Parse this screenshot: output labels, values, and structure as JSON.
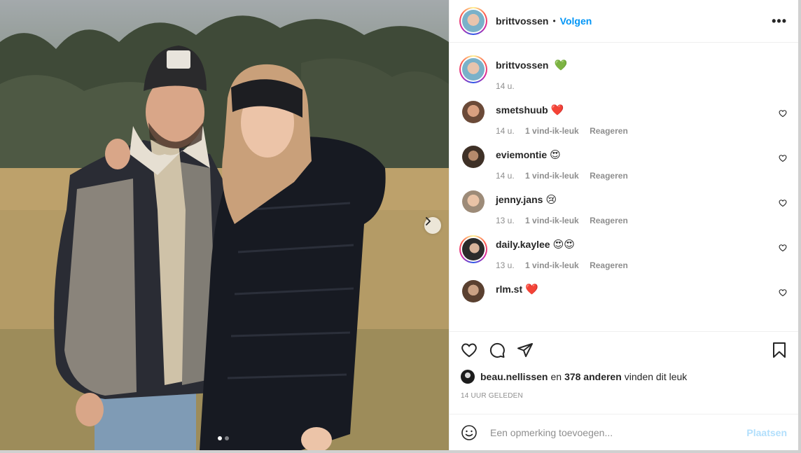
{
  "post": {
    "username": "brittvossen",
    "follow_label": "Volgen",
    "bullet": "•",
    "more_icon": "more-icon",
    "more_label": "•••",
    "caption": {
      "username": "brittvossen",
      "emoji": "💚",
      "time": "14 u."
    },
    "image": {
      "slides": 2,
      "active_slide": 1
    }
  },
  "comments": [
    {
      "username": "smetshuub",
      "text": "❤️",
      "time": "14 u.",
      "likes": "1 vind-ik-leuk",
      "reply": "Reageren",
      "avatar_color": "#6b4a38"
    },
    {
      "username": "eviemontie",
      "text": "😍",
      "time": "14 u.",
      "likes": "1 vind-ik-leuk",
      "reply": "Reageren",
      "avatar_color": "#3e3026"
    },
    {
      "username": "jenny.jans",
      "text": "😢",
      "time": "13 u.",
      "likes": "1 vind-ik-leuk",
      "reply": "Reageren",
      "avatar_color": "#c9a48a"
    },
    {
      "username": "daily.kaylee",
      "text": "😍😍",
      "time": "13 u.",
      "likes": "1 vind-ik-leuk",
      "reply": "Reageren",
      "avatar_color": "#2b2b2b"
    },
    {
      "username": "rlm.st",
      "text": "❤️",
      "avatar_color": "#5a4030"
    }
  ],
  "likes": {
    "liker": "beau.nellissen",
    "connector": "en",
    "others": "378 anderen",
    "suffix": "vinden dit leuk"
  },
  "timestamp": "14 UUR GELEDEN",
  "add_comment": {
    "placeholder": "Een opmerking toevoegen...",
    "post_label": "Plaatsen"
  },
  "colors": {
    "accent": "#0095f6",
    "post_disabled": "#b2dffc",
    "text": "#262626",
    "muted": "#8e8e8e"
  }
}
